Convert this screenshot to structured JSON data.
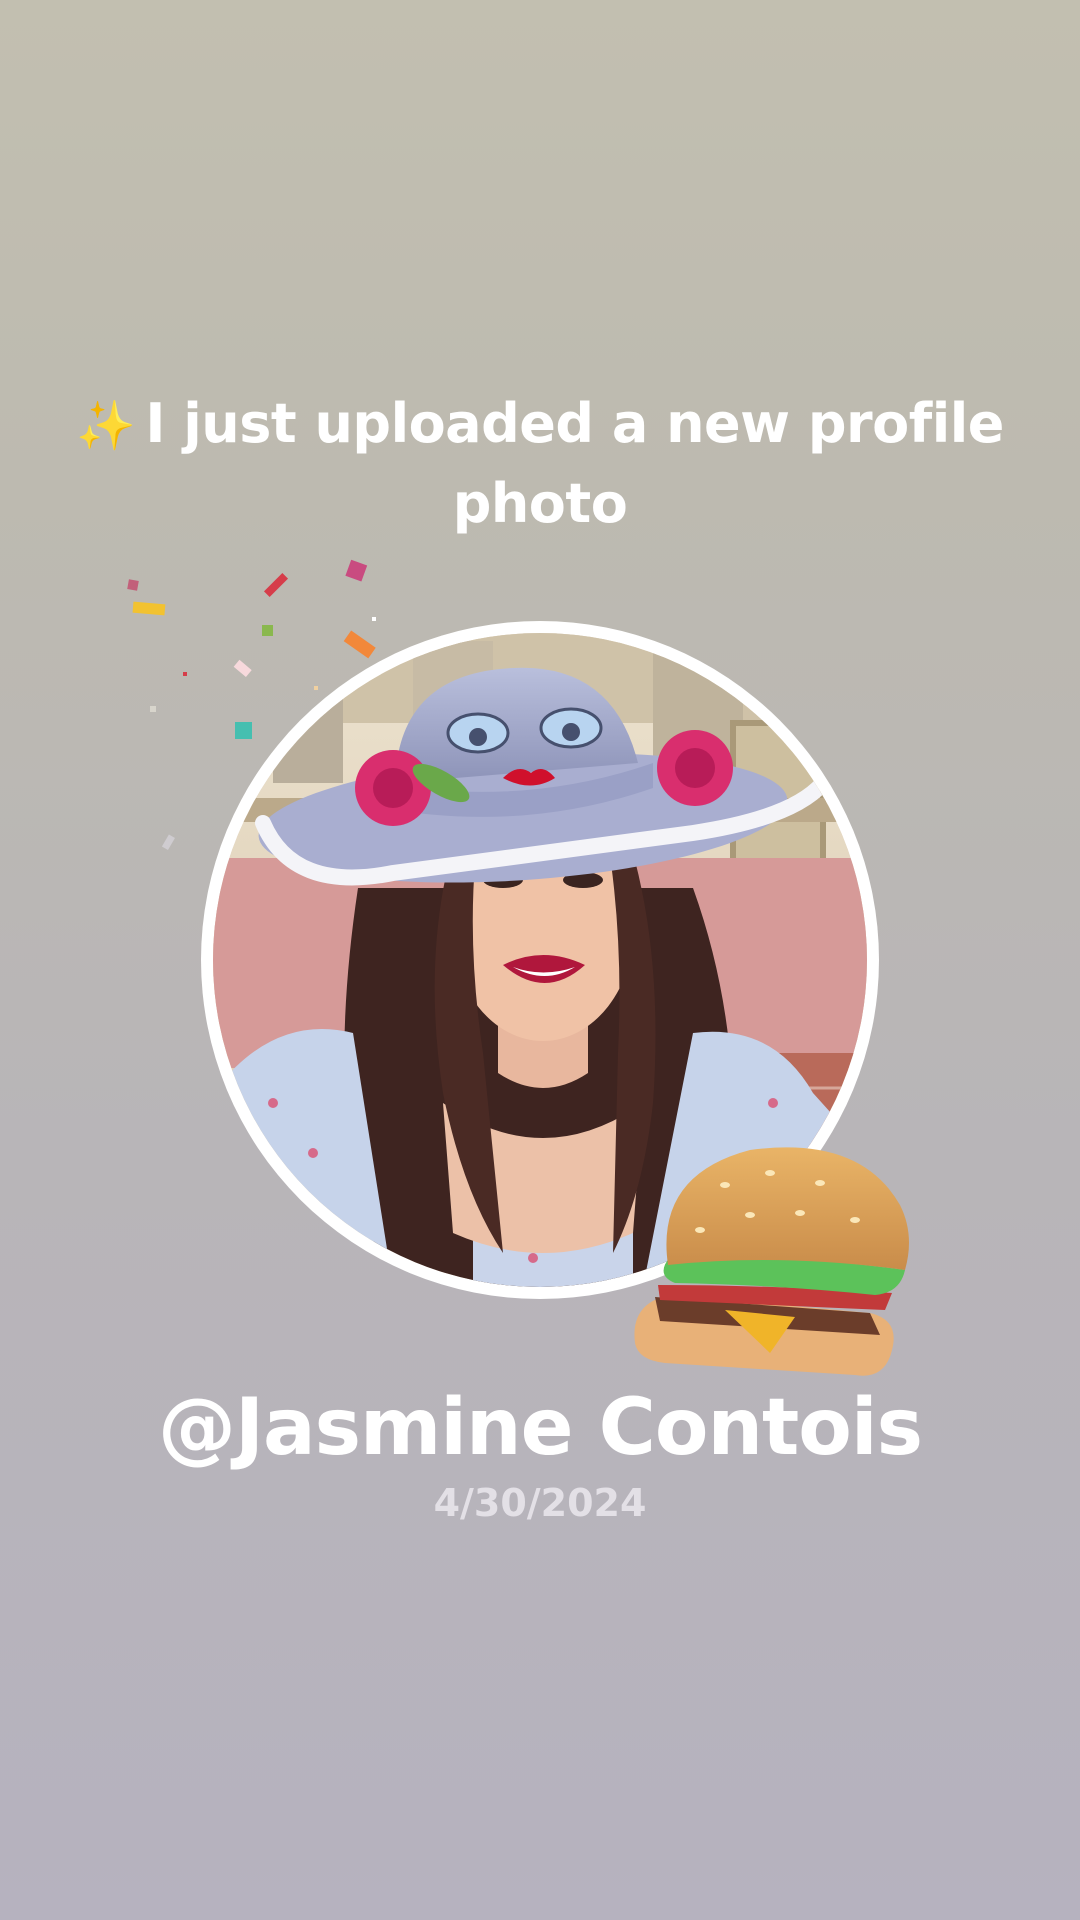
{
  "post": {
    "sparkle_icon": "✨",
    "headline": "I just uploaded a new profile photo",
    "username": "@Jasmine Contois",
    "date": "4/30/2024"
  },
  "stickers": {
    "burger_icon": "hamburger-emoji"
  },
  "colors": {
    "background_top": "#c2bfb0",
    "background_bottom": "#b6b2bf",
    "text": "#ffffff",
    "date_text": "#e3e0e6"
  }
}
